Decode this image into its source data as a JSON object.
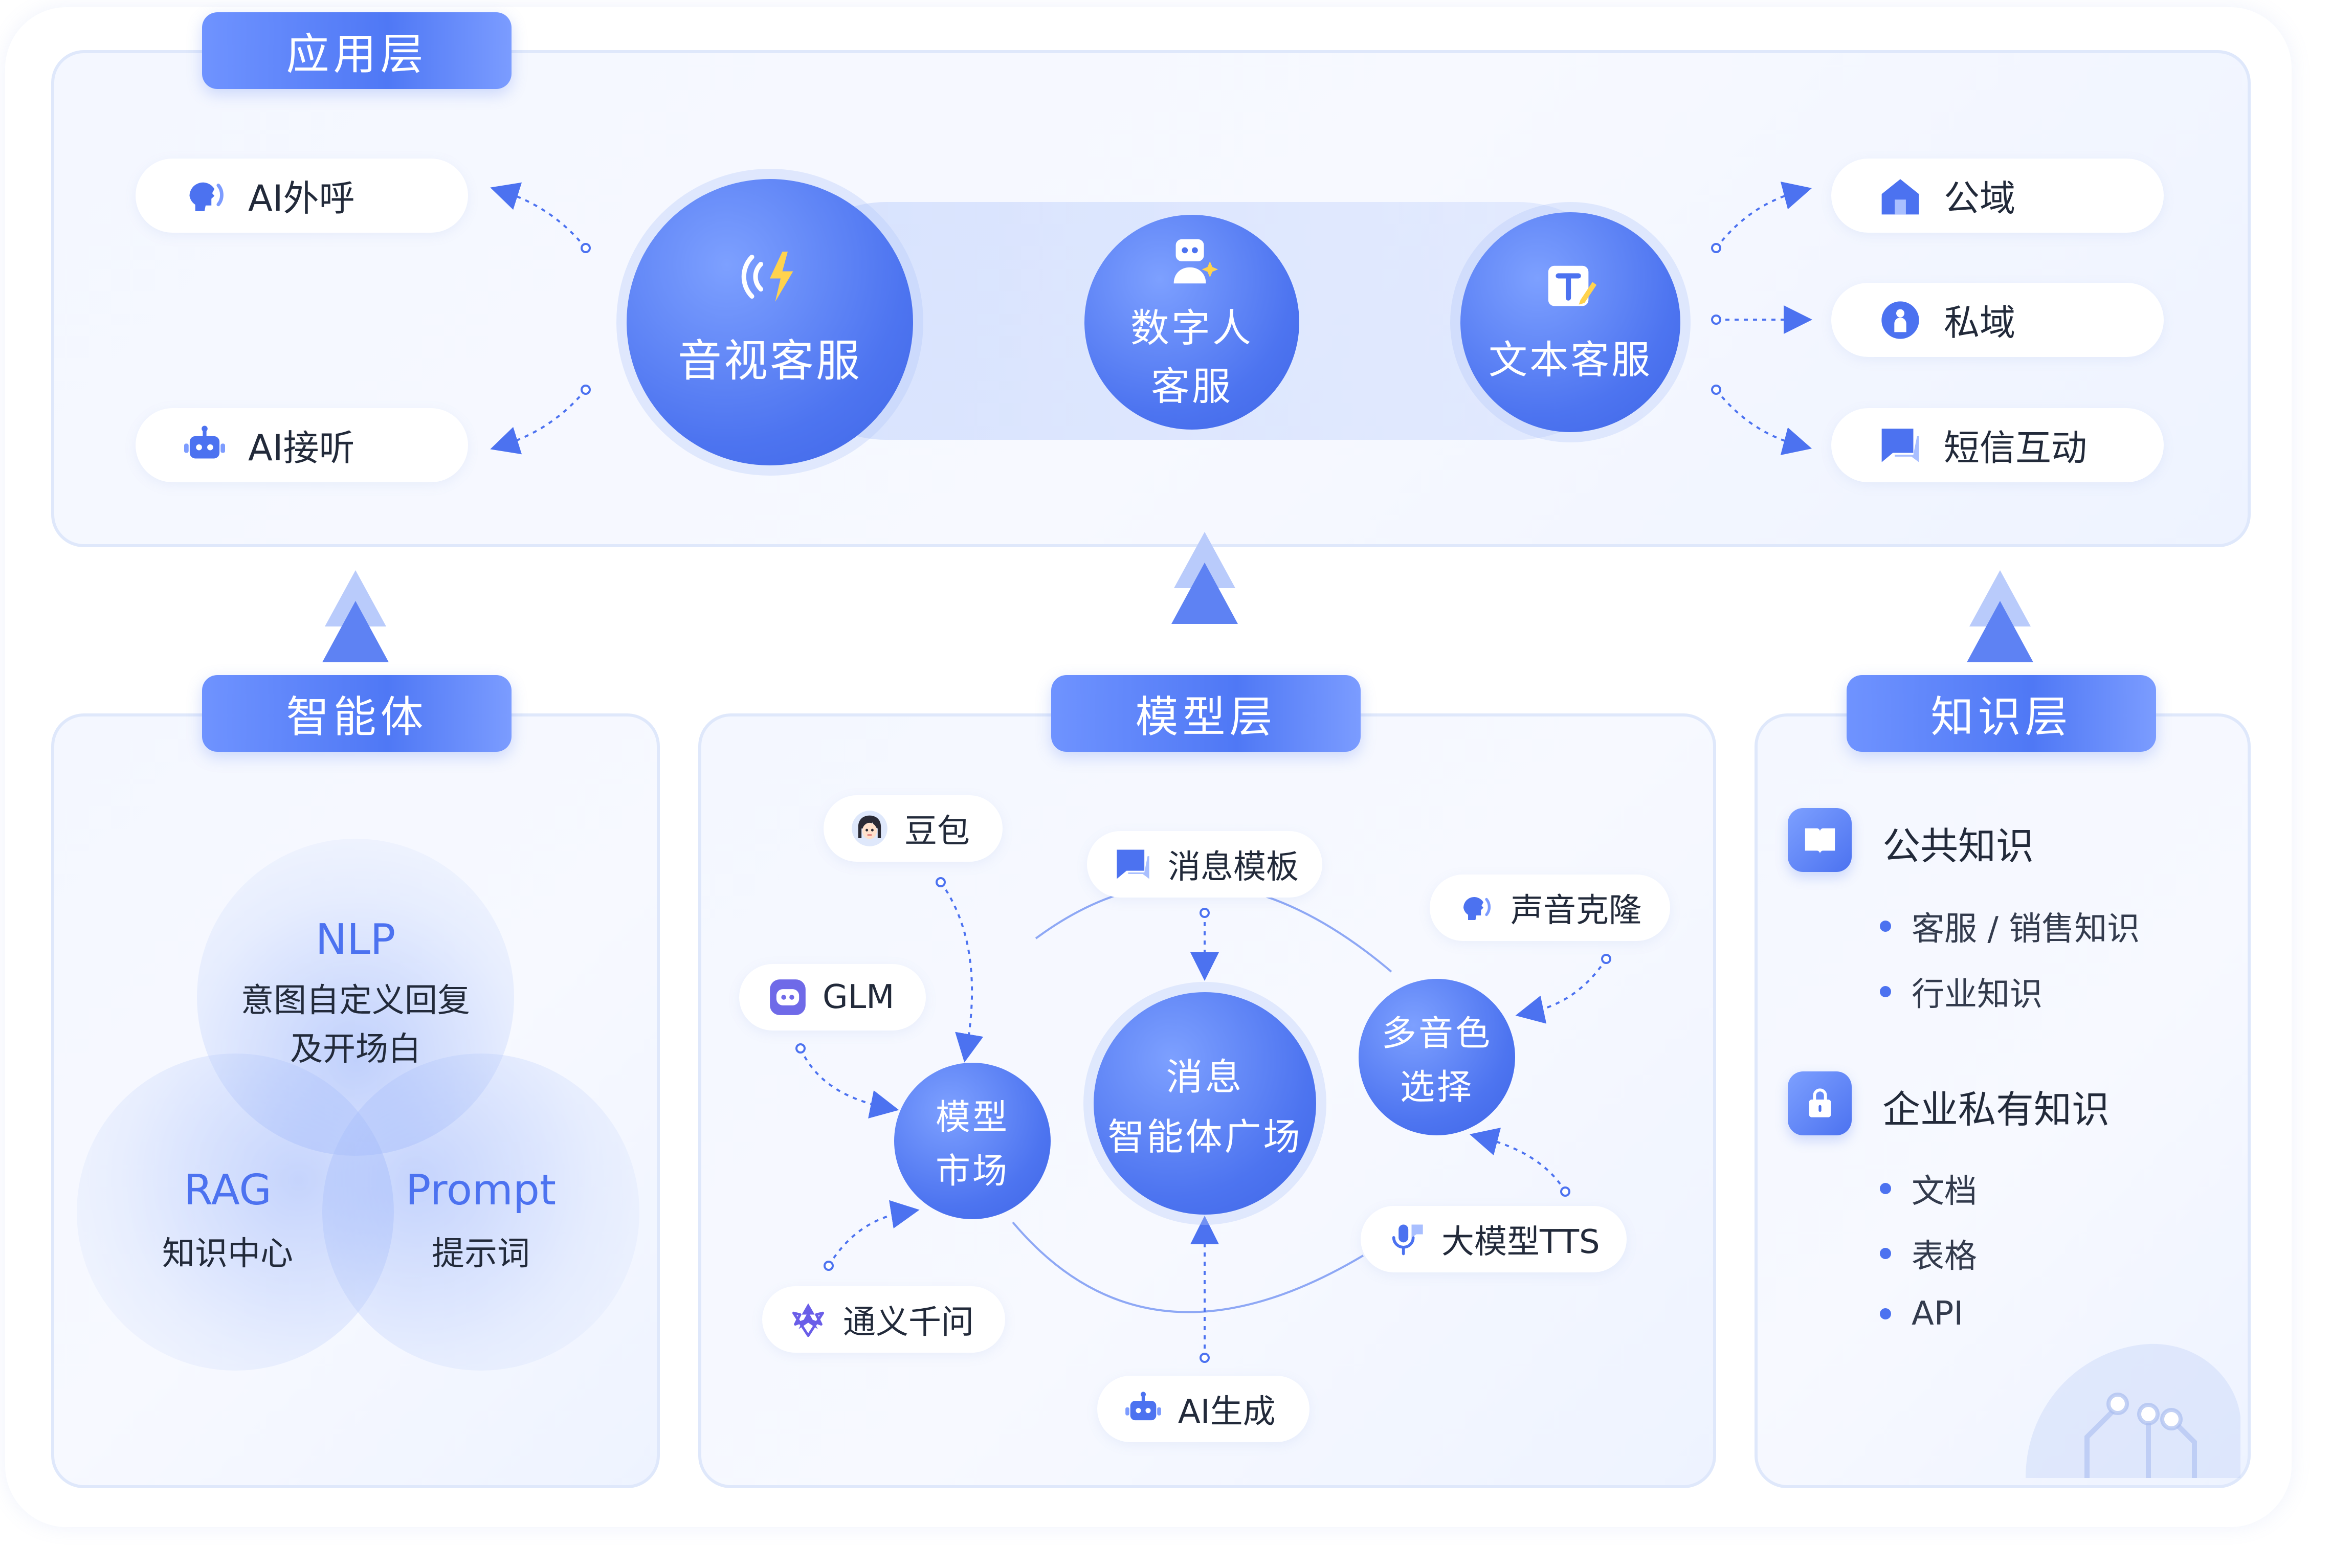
{
  "tags": {
    "application": "应用层",
    "agent": "智能体",
    "model": "模型层",
    "knowledge": "知识层"
  },
  "application": {
    "left_items": [
      {
        "label": "AI外呼",
        "icon": "speaking-head-icon"
      },
      {
        "label": "AI接听",
        "icon": "robot-icon"
      }
    ],
    "circles": [
      {
        "label": "音视客服",
        "icon": "signal-lightning-icon"
      },
      {
        "label_line1": "数字人",
        "label_line2": "客服",
        "icon": "digital-human-icon"
      },
      {
        "label": "文本客服",
        "icon": "text-edit-icon"
      }
    ],
    "right_items": [
      {
        "label": "公域",
        "icon": "house-icon"
      },
      {
        "label": "私域",
        "icon": "person-icon"
      },
      {
        "label": "短信互动",
        "icon": "chat-bubble-icon"
      }
    ]
  },
  "agent": {
    "top": {
      "title": "NLP",
      "line1": "意图自定义回复",
      "line2": "及开场白"
    },
    "left": {
      "title": "RAG",
      "line1": "知识中心"
    },
    "right": {
      "title": "Prompt",
      "line1": "提示词"
    }
  },
  "model": {
    "center": {
      "line1": "消息",
      "line2": "智能体广场"
    },
    "market": {
      "line1": "模型",
      "line2": "市场"
    },
    "voice": {
      "line1": "多音色",
      "line2": "选择"
    },
    "items": {
      "doubao": "豆包",
      "glm": "GLM",
      "tongyi": "通义千问",
      "msg_template": "消息模板",
      "voice_clone": "声音克隆",
      "tts": "大模型TTS",
      "ai_gen": "AI生成"
    }
  },
  "knowledge": {
    "public": {
      "title": "公共知识",
      "items": [
        "客服 / 销售知识",
        "行业知识"
      ]
    },
    "private": {
      "title": "企业私有知识",
      "items": [
        "文档",
        "表格",
        "API"
      ]
    }
  },
  "colors": {
    "accent": "#4c72f0",
    "tag_gradient_start": "#6f93ff",
    "panel_border": "#dfe8fb"
  }
}
